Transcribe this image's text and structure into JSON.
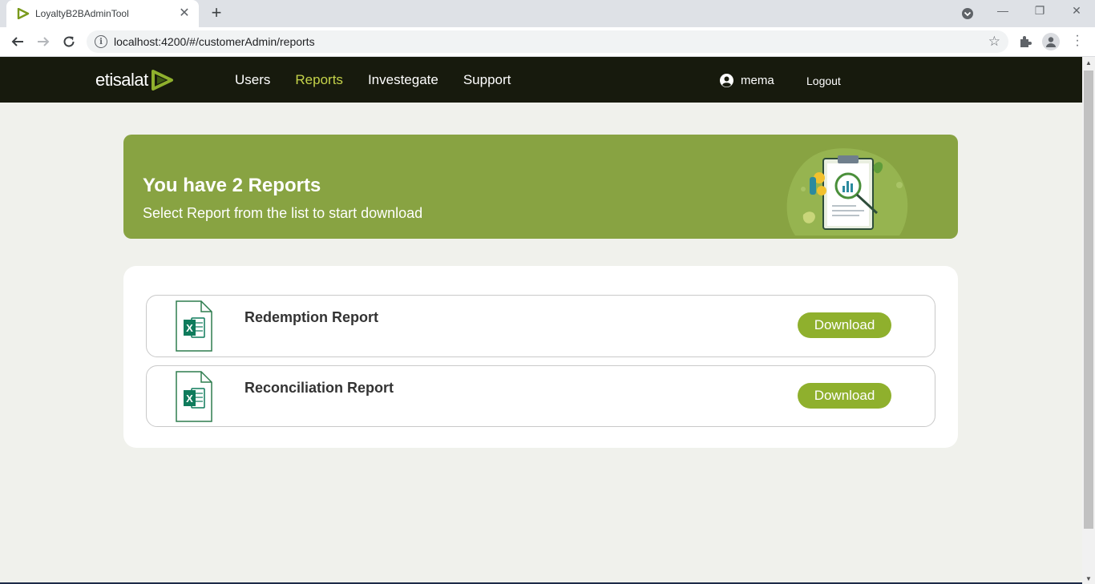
{
  "browser": {
    "tab_title": "LoyaltyB2BAdminTool",
    "tab_close": "✕",
    "new_tab": "+",
    "url": "localhost:4200/#/customerAdmin/reports"
  },
  "header": {
    "logo_text": "etisalat",
    "nav": [
      {
        "label": "Users",
        "active": false
      },
      {
        "label": "Reports",
        "active": true
      },
      {
        "label": "Investegate",
        "active": false
      },
      {
        "label": "Support",
        "active": false
      }
    ],
    "user_name": "mema",
    "logout_label": "Logout"
  },
  "banner": {
    "title": "You have 2 Reports",
    "subtitle": "Select Report from the list to start download"
  },
  "reports": [
    {
      "name": "Redemption Report",
      "button": "Download",
      "file_icon": "excel-file-icon"
    },
    {
      "name": "Reconciliation Report",
      "button": "Download",
      "file_icon": "excel-file-icon"
    }
  ],
  "colors": {
    "header_bg": "#171a0d",
    "nav_active": "#c5d34a",
    "banner_bg": "#88a342",
    "button_bg": "#8fb02d",
    "page_bg": "#f0f1ec"
  }
}
